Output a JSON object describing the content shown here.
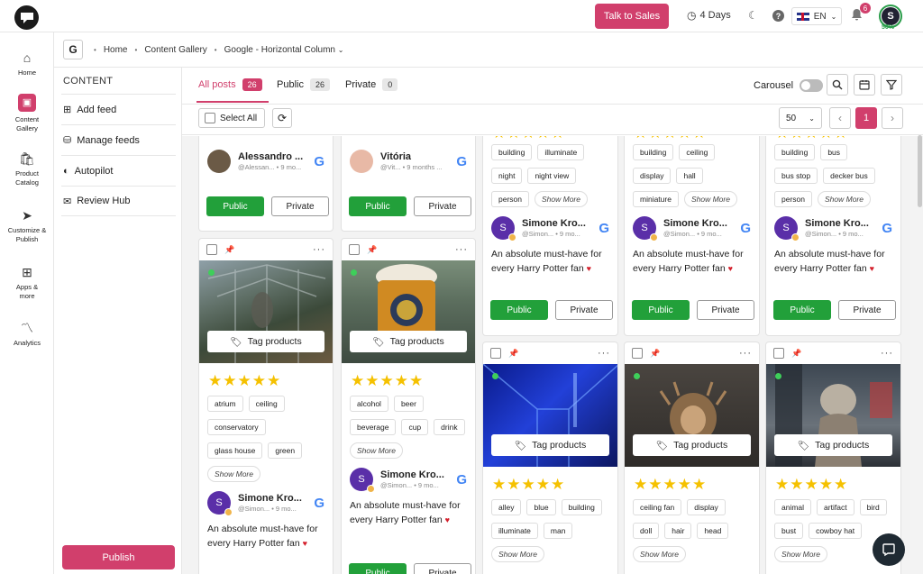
{
  "header": {
    "talk_to_sales": "Talk to Sales",
    "trial_days": "4 Days",
    "language": "EN",
    "notifications_count": "6",
    "avatar_letter": "S",
    "profile_completion": "50%"
  },
  "rail": [
    {
      "label": "Home",
      "icon": "home-icon"
    },
    {
      "label": "Content Gallery",
      "icon": "gallery-icon"
    },
    {
      "label": "Product Catalog",
      "icon": "bag-icon"
    },
    {
      "label": "Customize & Publish",
      "icon": "send-icon"
    },
    {
      "label": "Apps & more",
      "icon": "grid-icon"
    },
    {
      "label": "Analytics",
      "icon": "chart-icon"
    }
  ],
  "breadcrumb": {
    "logo_letter": "G",
    "home": "Home",
    "gallery": "Content Gallery",
    "current": "Google - Horizontal Column"
  },
  "content_menu": {
    "heading": "CONTENT",
    "items": [
      "Add feed",
      "Manage feeds",
      "Autopilot",
      "Review Hub"
    ],
    "publish": "Publish"
  },
  "tabs": [
    {
      "label": "All posts",
      "count": "26"
    },
    {
      "label": "Public",
      "count": "26"
    },
    {
      "label": "Private",
      "count": "0"
    }
  ],
  "toolbar": {
    "carousel_label": "Carousel",
    "select_all": "Select All",
    "per_page": "50",
    "current_page": "1"
  },
  "common": {
    "tag_products": "Tag products",
    "show_more": "Show More",
    "public_btn": "Public",
    "private_btn": "Private",
    "review_text": "An absolute must-have for every Harry Potter fan"
  },
  "cards": {
    "c1_top": {
      "name": "Alessandro ...",
      "handle": "@Alessan... • 9 mo..."
    },
    "c2_top": {
      "name": "Vitória",
      "handle": "@Vit... • 9 months ..."
    },
    "c3_top": {
      "tags": [
        "building",
        "illuminate",
        "night",
        "night view",
        "person"
      ],
      "name": "Simone Kro...",
      "handle": "@Simon... • 9 mo..."
    },
    "c4_top": {
      "tags": [
        "building",
        "ceiling",
        "display",
        "hall",
        "miniature"
      ],
      "name": "Simone Kro...",
      "handle": "@Simon... • 9 mo..."
    },
    "c5_top": {
      "tags": [
        "building",
        "bus",
        "bus stop",
        "decker bus",
        "person"
      ],
      "name": "Simone Kro...",
      "handle": "@Simon... • 9 mo..."
    },
    "c1_bot": {
      "tags": [
        "atrium",
        "ceiling",
        "conservatory",
        "glass house",
        "green"
      ],
      "name": "Simone Kro...",
      "handle": "@Simon... • 9 mo..."
    },
    "c2_bot": {
      "tags": [
        "alcohol",
        "beer",
        "beverage",
        "cup",
        "drink"
      ],
      "name": "Simone Kro...",
      "handle": "@Simon... • 9 mo..."
    },
    "c3_bot": {
      "tags": [
        "alley",
        "blue",
        "building",
        "illuminate",
        "man"
      ]
    },
    "c4_bot": {
      "tags": [
        "ceiling fan",
        "display",
        "doll",
        "hair",
        "head"
      ]
    },
    "c5_bot": {
      "tags": [
        "animal",
        "artifact",
        "bird",
        "bust",
        "cowboy hat"
      ]
    }
  },
  "colors": {
    "accent": "#d13f6c",
    "public_green": "#22a03a",
    "star": "#f5c100"
  }
}
